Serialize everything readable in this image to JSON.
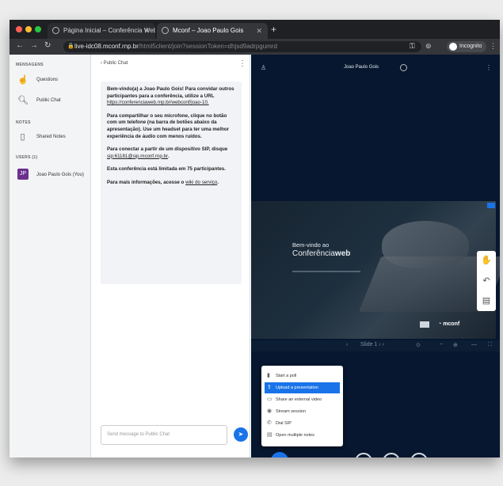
{
  "browser": {
    "tabs": [
      {
        "title": "Página Inicial – Conferência Web"
      },
      {
        "title": "Mconf – Joao Paulo Gois"
      }
    ],
    "url": {
      "host": "live-idc08.mconf.rnp.br",
      "path": "/html5client/join?sessionToken=dhjsd9adrpgumrd"
    },
    "incognito_label": "Incognito"
  },
  "sidebar": {
    "messages_header": "MENSAGENS",
    "questions": "Questions",
    "public_chat": "Public Chat",
    "notes_header": "NOTES",
    "shared_notes": "Shared Notes",
    "users_header": "USERS (1)",
    "user_name": "Joao Paulo Gois (You)",
    "user_initials": "JP"
  },
  "chat": {
    "header": "Public Chat",
    "welcome_prefix": "Bem-vindo(a) a ",
    "welcome_name": "Joao Paulo Gois",
    "welcome_suffix": "! Para convidar outros participantes para a conferência, utilize a URL",
    "invite_url": "https://conferenciaweb.rnp.br/webconf/joao-10.",
    "share_mic": "Para compartilhar o seu microfone, clique no botão com um telefone (na barra de botões abaixo da apresentação). Use um headset para ter uma melhor experiência de áudio com menos ruídos.",
    "sip_prefix": "Para conectar a partir de um dispositivo SIP, disque ",
    "sip_address": "sip:61181@sip.mconf.rnp.br",
    "sip_suffix": ".",
    "limit": "Esta conferência está limitada em 75 participantes.",
    "more_prefix": "Para mais informações, acesse o ",
    "more_link": "wiki do serviço",
    "more_suffix": ".",
    "input_placeholder": "Send message to Public Chat"
  },
  "meeting": {
    "title": "Joao Paulo Gois",
    "slide": {
      "welcome": "Bem-vindo ao",
      "brand_light": "Conferência",
      "brand_bold": "web",
      "logo": "mconf"
    },
    "slide_label": "Slide 1 ‹ ›",
    "menu": [
      {
        "label": "Start a poll",
        "icon": "poll-icon"
      },
      {
        "label": "Upload a presentation",
        "icon": "upload-icon"
      },
      {
        "label": "Share an external video",
        "icon": "video-icon"
      },
      {
        "label": "Stream session",
        "icon": "stream-icon"
      },
      {
        "label": "Dial SIP",
        "icon": "phone-icon"
      },
      {
        "label": "Open multiple notes",
        "icon": "notes-icon"
      }
    ]
  },
  "colors": {
    "accent": "#1a73e8",
    "meeting_bg": "#06172f",
    "sidebar_bg": "#f3f4f6",
    "user_avatar": "#6b2f8e"
  }
}
